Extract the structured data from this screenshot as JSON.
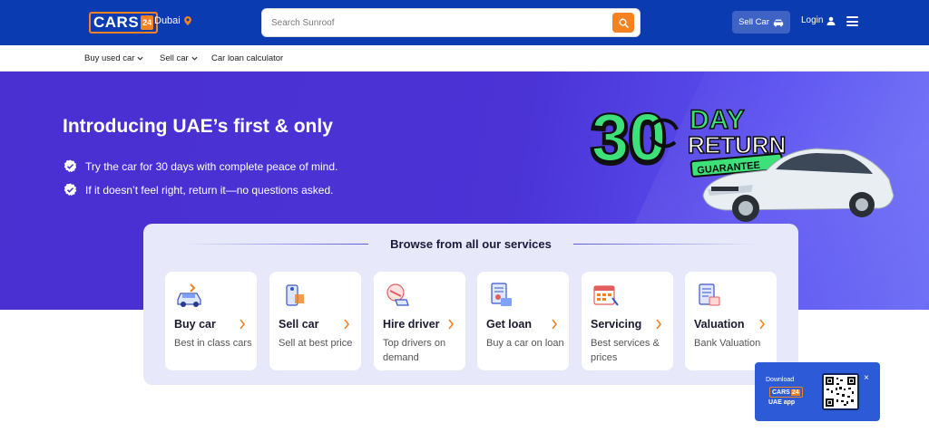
{
  "header": {
    "logo_text": "CARS",
    "logo_num": "24",
    "city": "Dubai",
    "search_placeholder": "Search Sunroof",
    "sell_car_label": "Sell Car",
    "login_label": "Login"
  },
  "subnav": {
    "items": [
      "Buy used car",
      "Sell car",
      "Car loan calculator"
    ]
  },
  "hero": {
    "title": "Introducing UAE’s first & only",
    "points": [
      "Try the car for 30 days with complete peace of mind.",
      "If it doesn’t feel right, return it—no questions asked."
    ],
    "badge": {
      "number": "30",
      "day": "DAY",
      "return": "RETURN",
      "guarantee": "GUARANTEE"
    }
  },
  "services": {
    "title": "Browse from all our services",
    "items": [
      {
        "title": "Buy car",
        "desc": "Best in class cars",
        "icon": "car-icon"
      },
      {
        "title": "Sell car",
        "desc": "Sell at best price",
        "icon": "price-tag-icon"
      },
      {
        "title": "Hire driver",
        "desc": "Top drivers on demand",
        "icon": "driver-icon"
      },
      {
        "title": "Get loan",
        "desc": "Buy a car on loan",
        "icon": "loan-document-icon"
      },
      {
        "title": "Servicing",
        "desc": "Best services & prices",
        "icon": "calendar-tools-icon"
      },
      {
        "title": "Valuation",
        "desc": "Bank Valuation",
        "icon": "valuation-document-icon"
      }
    ]
  },
  "download": {
    "label": "Download",
    "logo_text": "CARS",
    "logo_num": "24",
    "sub": "UAE app",
    "close": "×"
  },
  "colors": {
    "brand_blue": "#0b3bb0",
    "accent_orange": "#f58220",
    "hero_purple": "#4a2fd1",
    "badge_green": "#3ee07a"
  }
}
